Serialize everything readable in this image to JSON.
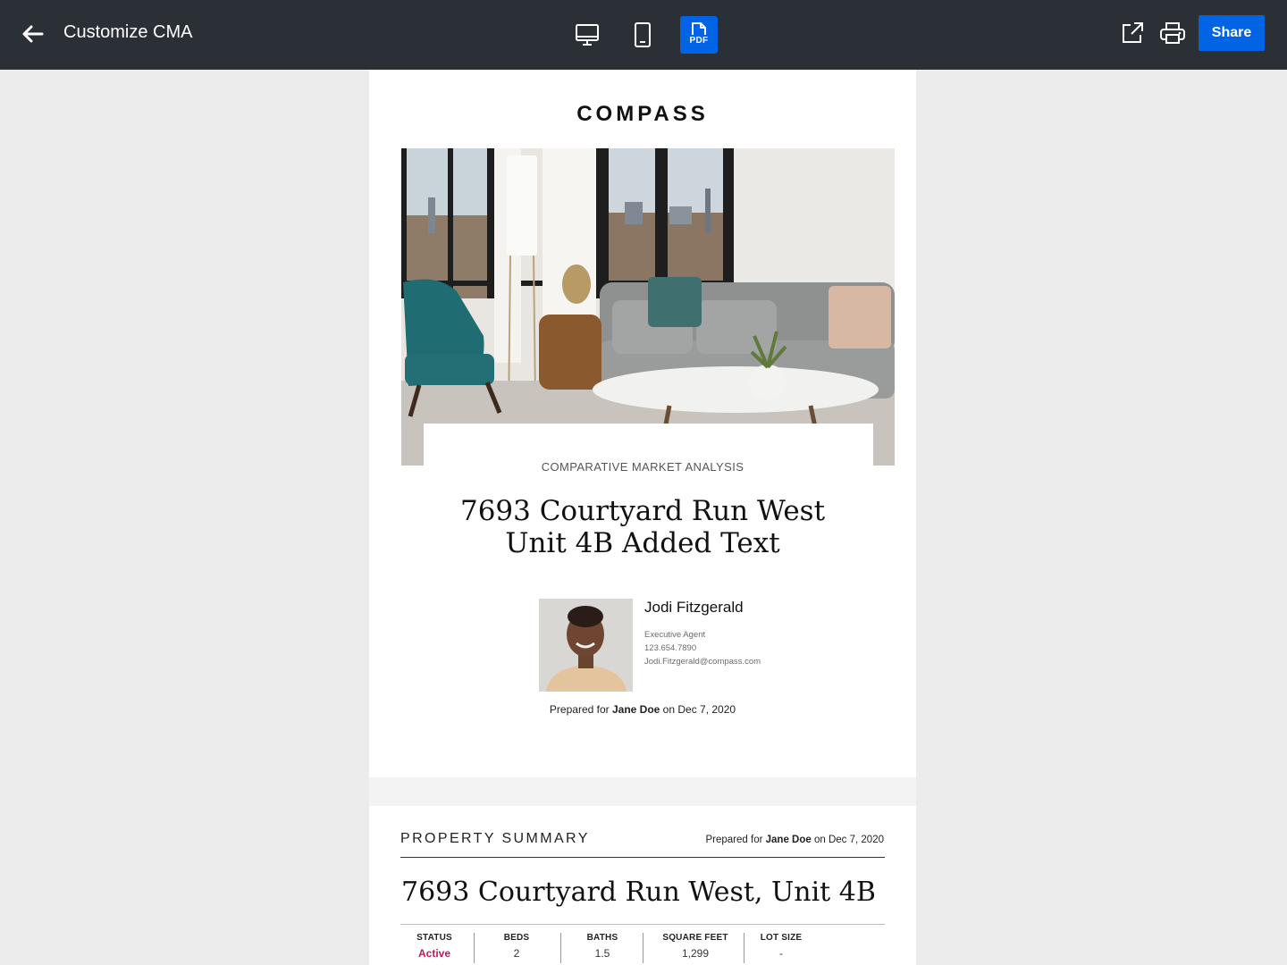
{
  "header": {
    "title": "Customize CMA",
    "pdf_label": "PDF",
    "share_label": "Share"
  },
  "cover": {
    "logo": "COMPASS",
    "eyebrow": "COMPARATIVE MARKET ANALYSIS",
    "headline_line1": "7693 Courtyard Run West",
    "headline_line2": "Unit 4B Added Text",
    "agent": {
      "name": "Jodi Fitzgerald",
      "title": "Executive Agent",
      "phone": "123.654.7890",
      "email": "Jodi.Fitzgerald@compass.com"
    },
    "prepared_prefix": "Prepared for",
    "client": "Jane Doe",
    "prepared_on": "on Dec 7, 2020"
  },
  "summary": {
    "title": "PROPERTY SUMMARY",
    "prepared_prefix": "Prepared for",
    "client": "Jane Doe",
    "prepared_on": "on Dec 7, 2020",
    "address": "7693 Courtyard Run West, Unit 4B",
    "facts": [
      {
        "label": "STATUS",
        "value": "Active"
      },
      {
        "label": "BEDS",
        "value": "2"
      },
      {
        "label": "BATHS",
        "value": "1.5"
      },
      {
        "label": "SQUARE FEET",
        "value": "1,299"
      },
      {
        "label": "LOT SIZE",
        "value": "-"
      }
    ]
  },
  "colors": {
    "topbar": "#2b2f36",
    "accent": "#0064e5",
    "status_active": "#c2185b"
  },
  "icons": [
    "back-arrow-icon",
    "desktop-icon",
    "mobile-icon",
    "pdf-icon",
    "open-external-icon",
    "print-icon"
  ]
}
